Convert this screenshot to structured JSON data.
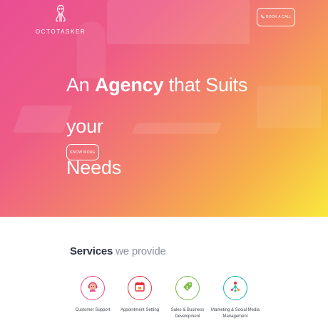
{
  "brand": {
    "name": "OCTOTASKER",
    "logo_icon": "octopus-icon"
  },
  "header": {
    "book_call_label": "BOOK A CALL",
    "book_call_icon": "phone-icon"
  },
  "hero": {
    "title_prefix": "An",
    "title_emphasis": "Agency",
    "title_rest_line1": "that Suits your",
    "title_line2": "Needs",
    "cta_label": "KNOW MORE"
  },
  "services": {
    "heading_strong": "Services",
    "heading_light": "we provide",
    "items": [
      {
        "label": "Customer Support",
        "icon": "headset-icon",
        "color": "#e84f8e"
      },
      {
        "label": "Appointment Setting",
        "icon": "calendar-icon",
        "color": "#e3313e"
      },
      {
        "label": "Sales & Business Development",
        "label_line1": "Sales & Business",
        "label_line2": "Development",
        "icon": "tag-icon",
        "color": "#7cbd47"
      },
      {
        "label": "Marketing & Social Media Management",
        "label_line1": "Marketing & Social Media",
        "label_line2": "Management",
        "icon": "network-icon",
        "color": "#19b7a5"
      }
    ]
  },
  "colors": {
    "gradient_start": "#e94e93",
    "gradient_end": "#f9e83c",
    "heading": "#2f3545"
  }
}
